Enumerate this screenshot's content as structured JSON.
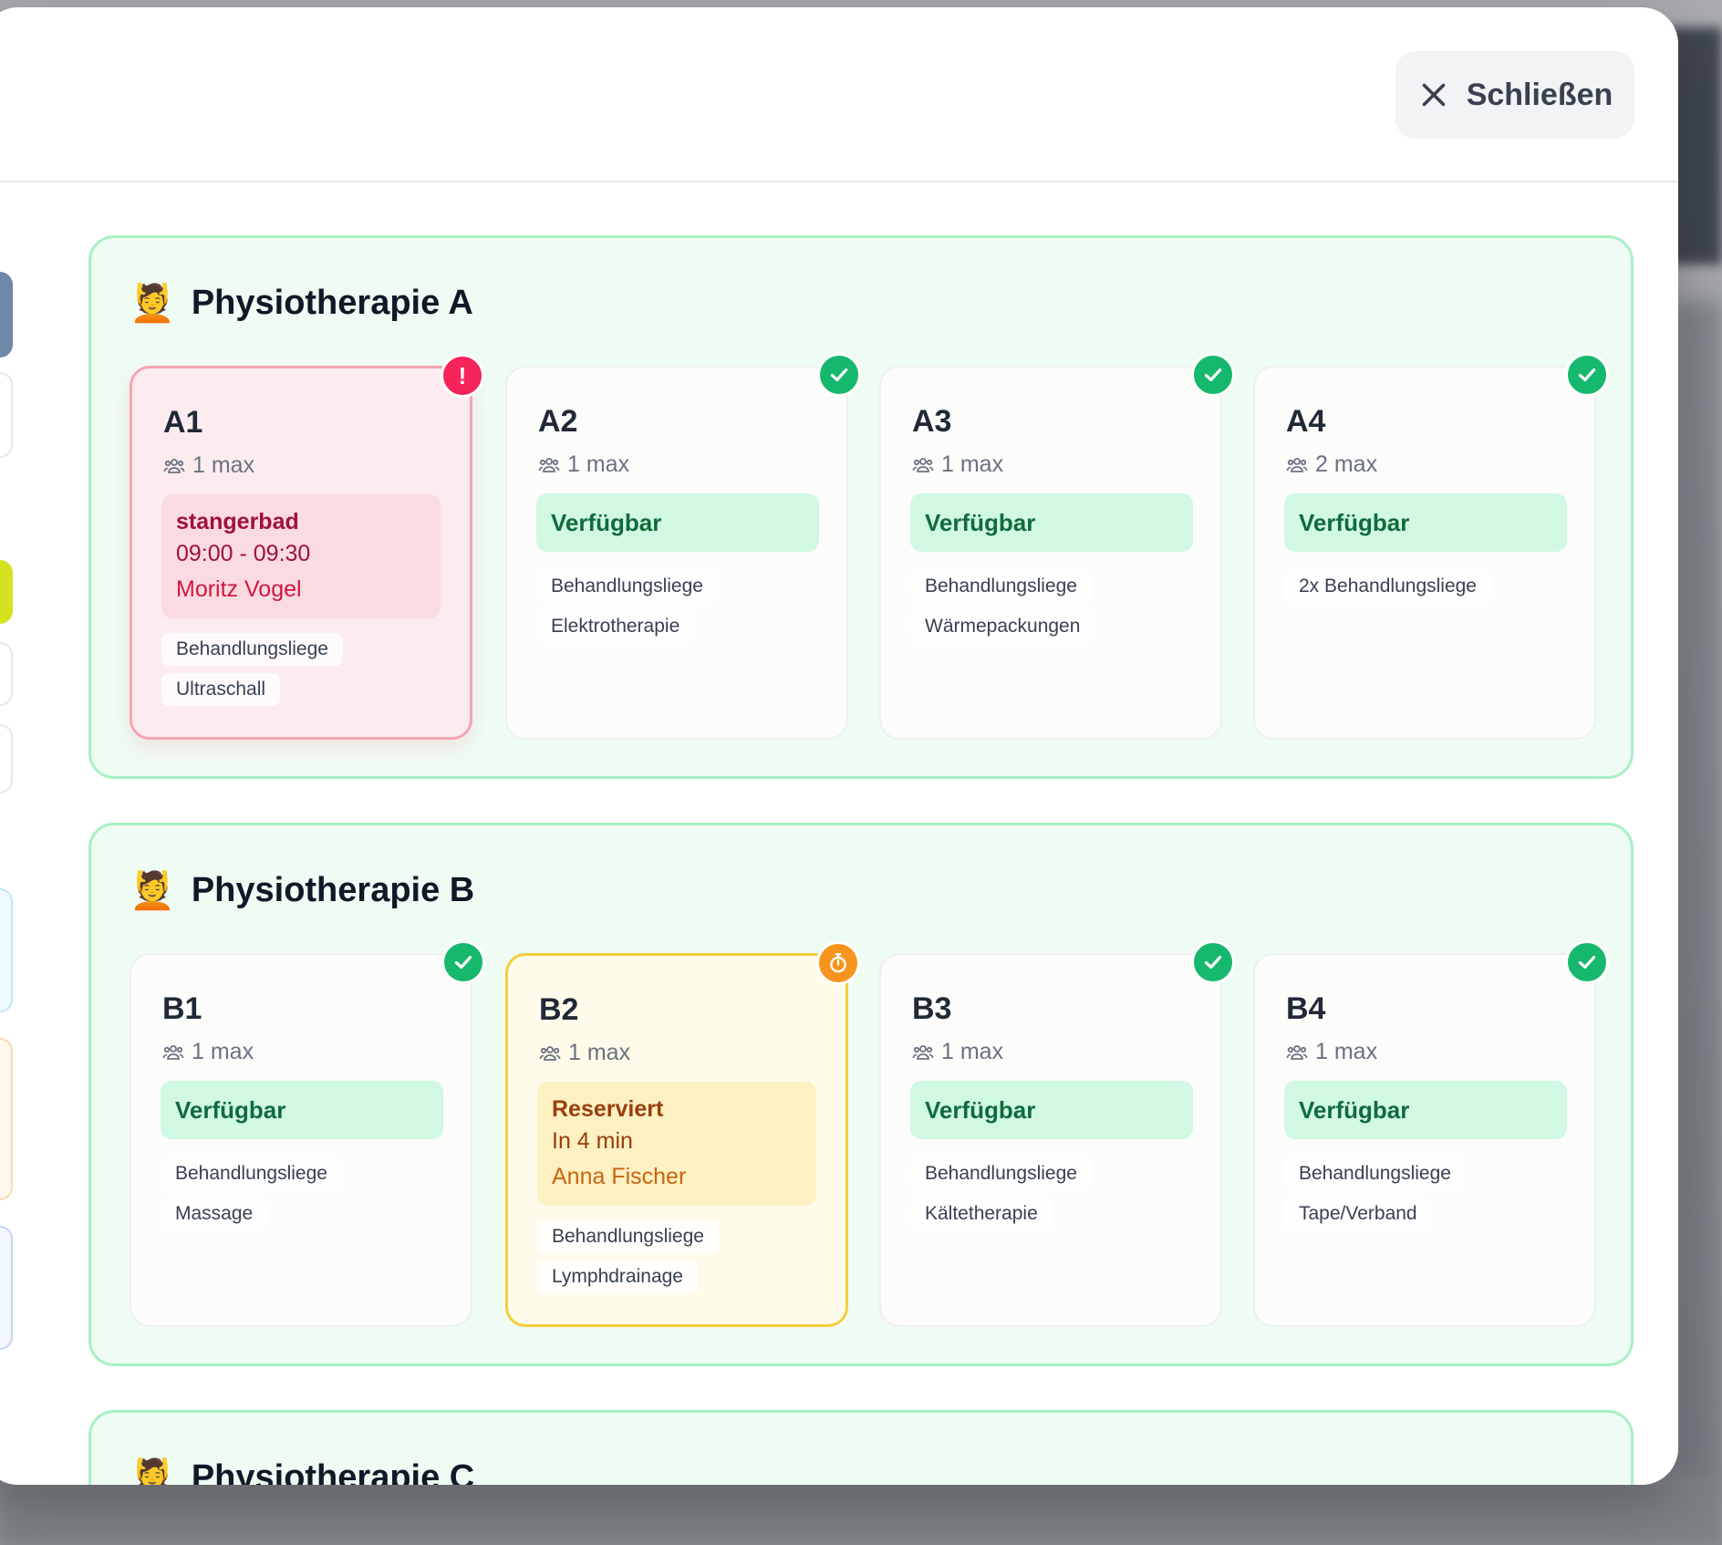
{
  "close_label": "Schließen",
  "groups": [
    {
      "title": "Physiotherapie A",
      "icon": "person-massage-icon",
      "rooms": [
        {
          "name": "A1",
          "capacity": "1 max",
          "state": "conflict",
          "booking": {
            "title": "stangerbad",
            "time": "09:00 - 09:30",
            "patient": "Moritz Vogel"
          },
          "equipment": [
            "Behandlungsliege",
            "Ultraschall"
          ]
        },
        {
          "name": "A2",
          "capacity": "1 max",
          "state": "available",
          "status": "Verfügbar",
          "equipment": [
            "Behandlungsliege",
            "Elektrotherapie"
          ]
        },
        {
          "name": "A3",
          "capacity": "1 max",
          "state": "available",
          "status": "Verfügbar",
          "equipment": [
            "Behandlungsliege",
            "Wärmepackungen"
          ]
        },
        {
          "name": "A4",
          "capacity": "2 max",
          "state": "available",
          "status": "Verfügbar",
          "equipment": [
            "2x Behandlungsliege"
          ]
        }
      ]
    },
    {
      "title": "Physiotherapie B",
      "icon": "person-massage-icon",
      "rooms": [
        {
          "name": "B1",
          "capacity": "1 max",
          "state": "available",
          "status": "Verfügbar",
          "equipment": [
            "Behandlungsliege",
            "Massage"
          ]
        },
        {
          "name": "B2",
          "capacity": "1 max",
          "state": "reserved",
          "booking": {
            "title": "Reserviert",
            "time": "In 4 min",
            "patient": "Anna Fischer"
          },
          "equipment": [
            "Behandlungsliege",
            "Lymphdrainage"
          ]
        },
        {
          "name": "B3",
          "capacity": "1 max",
          "state": "available",
          "status": "Verfügbar",
          "equipment": [
            "Behandlungsliege",
            "Kältetherapie"
          ]
        },
        {
          "name": "B4",
          "capacity": "1 max",
          "state": "available",
          "status": "Verfügbar",
          "equipment": [
            "Behandlungsliege",
            "Tape/Verband"
          ]
        }
      ]
    },
    {
      "title": "Physiotherapie C",
      "icon": "person-massage-icon",
      "rooms": []
    }
  ],
  "colors": {
    "group_bg": "#effcf4",
    "group_border": "#a7f0c3",
    "available_bg": "#d1f8e2",
    "available_text": "#106b3c",
    "conflict_border": "#f4a5b3",
    "reserved_border": "#f6cd3b",
    "badge_ok": "#16b86d",
    "badge_warn": "#f5245a",
    "badge_time": "#f7941d"
  }
}
